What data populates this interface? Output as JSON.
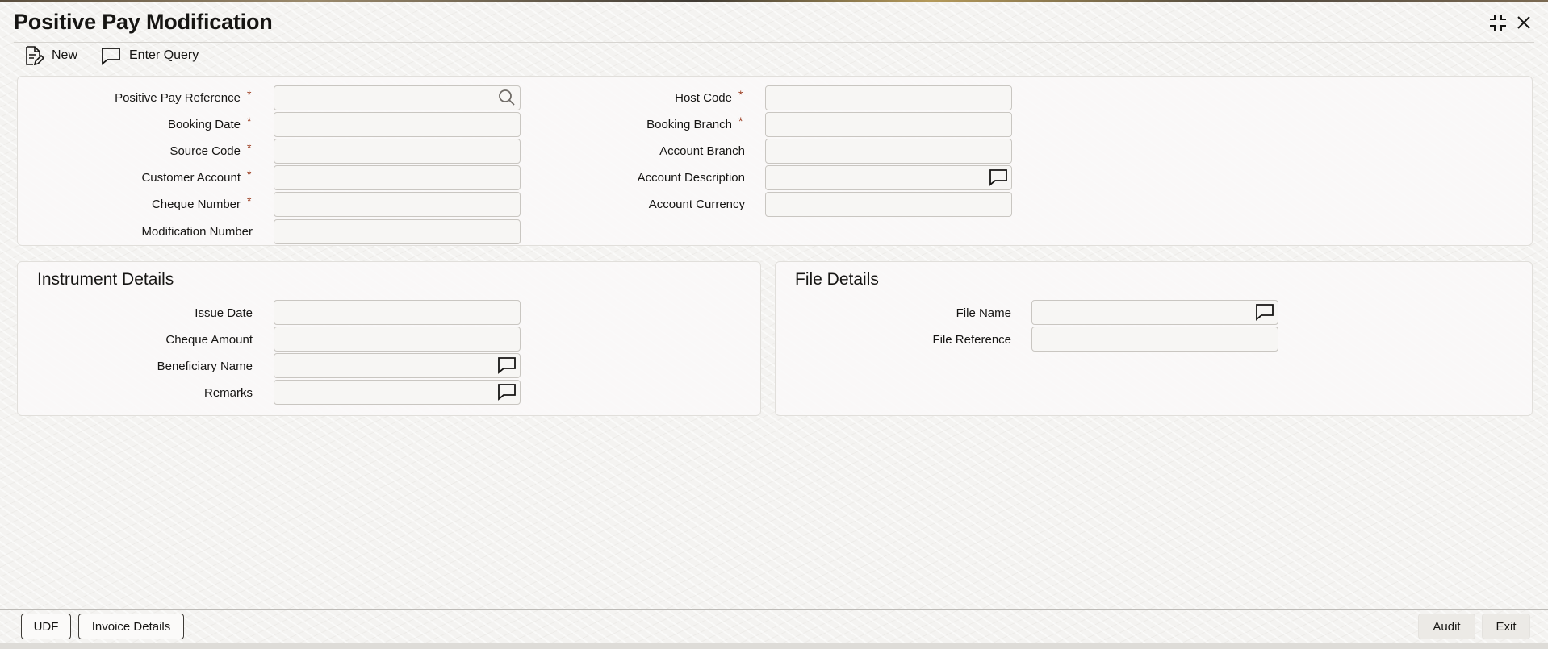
{
  "header": {
    "title": "Positive Pay Modification"
  },
  "window_controls": {
    "maximize_icon": "maximize-icon",
    "close_icon": "close-icon"
  },
  "toolbar": {
    "new_label": "New",
    "enter_query_label": "Enter Query"
  },
  "main": {
    "left_fields": {
      "positive_pay_reference": "Positive Pay Reference",
      "booking_date": "Booking Date",
      "source_code": "Source Code",
      "customer_account": "Customer Account",
      "cheque_number": "Cheque Number",
      "modification_number": "Modification Number"
    },
    "right_fields": {
      "host_code": "Host Code",
      "booking_branch": "Booking Branch",
      "account_branch": "Account Branch",
      "account_description": "Account Description",
      "account_currency": "Account Currency"
    },
    "required_mark": "*"
  },
  "instrument_details": {
    "title": "Instrument Details",
    "issue_date": "Issue Date",
    "cheque_amount": "Cheque Amount",
    "beneficiary_name": "Beneficiary Name",
    "remarks": "Remarks"
  },
  "file_details": {
    "title": "File Details",
    "file_name": "File Name",
    "file_reference": "File Reference"
  },
  "footer": {
    "udf_label": "UDF",
    "invoice_details_label": "Invoice Details",
    "audit_label": "Audit",
    "exit_label": "Exit"
  },
  "colors": {
    "required_asterisk": "#9b3c1f",
    "border": "#c9c6c1"
  }
}
